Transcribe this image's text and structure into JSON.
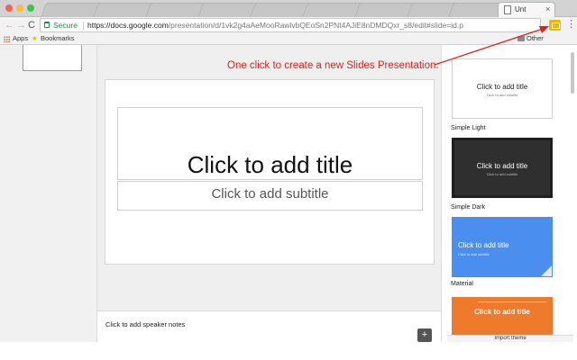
{
  "browser": {
    "tab_title": "Unt",
    "close_glyph": "×",
    "url_secure_label": "Secure",
    "url_host": "https://docs.google.com",
    "url_path": "/presentation/d/1vk2g4aAeMooRawlvbQEoSn2PNt4AJiE8nDMDQxr_s8/edit#slide=id.p",
    "back_glyph": "←",
    "forward_glyph": "→",
    "reload_glyph": "C",
    "menu_glyph": "⋮",
    "extension_icon": "slides-icon"
  },
  "bookmarks": {
    "apps_label": "Apps",
    "bookmarks_label": "Bookmarks",
    "other_label": "Other Bookmarks"
  },
  "slide": {
    "title_placeholder": "Click to add title",
    "subtitle_placeholder": "Click to add subtitle"
  },
  "notes": {
    "placeholder": "Click to add speaker notes",
    "button_glyph": "+"
  },
  "themes": {
    "items": [
      {
        "name": "Simple Light",
        "preview_title": "Click to add title",
        "preview_subtitle": "Click to add subtitle",
        "color": "#ffffff"
      },
      {
        "name": "Simple Dark",
        "preview_title": "Click to add title",
        "preview_subtitle": "Click to add subtitle",
        "color": "#2f2f2f"
      },
      {
        "name": "Material",
        "preview_title": "Click to add title",
        "preview_subtitle": "Click to add subtitle",
        "color": "#4a8ef0"
      },
      {
        "name": "",
        "preview_title": "Click to add title",
        "preview_subtitle": "",
        "color": "#f07a2c"
      }
    ],
    "import_label": "Import theme"
  },
  "annotation": {
    "text": "One click to create a new Slides Presentation.",
    "color": "#e2231a"
  }
}
